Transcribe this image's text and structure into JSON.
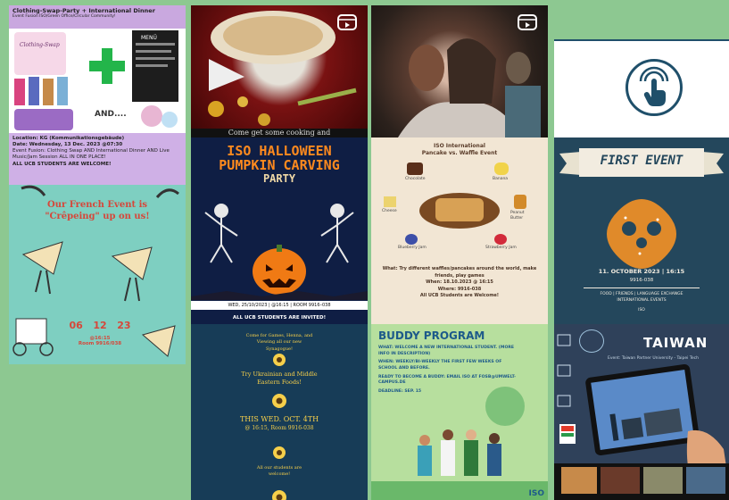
{
  "tile1": {
    "title": "Clothing-Swap-Party + International Dinner",
    "subtitle": "Event Fusion ISO/Green Office/Circular Community!",
    "and_text": "AND....",
    "menu_text": "MENÜ",
    "location": "Location: KG (Kommunikationsgebäude)",
    "date": "Date: Wednesday, 13 Dec. 2023 @07:30",
    "fusion": "Event Fusion: Clothing Swap AND International Dinner AND Live Music/Jam Session ALL IN ONE PLACE!",
    "welcome": "ALL UCB STUDENTS ARE WELCOME!"
  },
  "tile2": {
    "overlay": "Come get some cooking and"
  },
  "tile5": {
    "title_line1": "ISO HALLOWEEN",
    "title_line2": "PUMPKIN CARVING",
    "title_line3": "PARTY",
    "info": "WED, 25/10/2023  |  @16:15  |  ROOM 9916–038",
    "welcome": "ALL UCB STUDENTS ARE INVITED!"
  },
  "tile6": {
    "title_line1": "ISO International",
    "title_line2": "Pancake vs. Waffle Event",
    "toppings": [
      "Chocolate",
      "Banana",
      "Cheese",
      "Strawberry Jam",
      "Blueberry Jam",
      "Peanut Butter"
    ],
    "what": "What: Try different waffles/pancakes around the world, make friends, play games",
    "when": "When: 18.10.2023 @ 16:15",
    "where": "Where: 9916-038",
    "welcome": "All UCB Students are Welcome!"
  },
  "tile7": {
    "title": "FIRST EVENT",
    "date": "11. OCTOBER 2023 | 16:15",
    "room": "9916-038",
    "tags": "FOOD | FRIENDS | LANGUAGE EXCHANGE",
    "tags2": "INTERNATIONAL EVENTS",
    "org": "ISO"
  },
  "tile8": {
    "title_line1": "Our French Event is",
    "title_line2": "\"Crêpeing\" up on us!",
    "d1": "06",
    "d2": "12",
    "d3": "23",
    "time": "@16:15",
    "room": "Room 9916/038"
  },
  "tile9": {
    "line1": "Come for Games, Henna, and",
    "line2": "Viewing all our new",
    "line3": "Synagogue!",
    "food1": "Try Ukrainian and Middle",
    "food2": "Eastern Foods!",
    "date1": "THIS WED. OCT. 4TH",
    "date2": "@ 16:15, Room 9916-038",
    "welcome1": "All our students are",
    "welcome2": "welcome!"
  },
  "tile10": {
    "title": "BUDDY PROGRAM",
    "what": "WHAT: WELCOME A NEW INTERNATIONAL STUDENT. (MORE INFO IN DESCRIPTION)",
    "when": "WHEN: WEEKLY/BI-WEEKLY THE FIRST FEW WEEKS OF SCHOOL AND BEFORE.",
    "ready": "READY TO BECOME A BUDDY: EMAIL ISO AT FOSB@UMWELT-CAMPUS.DE",
    "deadline": "DEADLINE: SEP. 15",
    "org": "ISO"
  },
  "tile11": {
    "title": "TAIWAN",
    "subtitle": "Event: Taiwan Partner University - Taipei Tech"
  },
  "colors": {
    "page_bg": "#8dc891",
    "accent_navy": "#1f4f6a",
    "purple": "#c9a8df"
  }
}
